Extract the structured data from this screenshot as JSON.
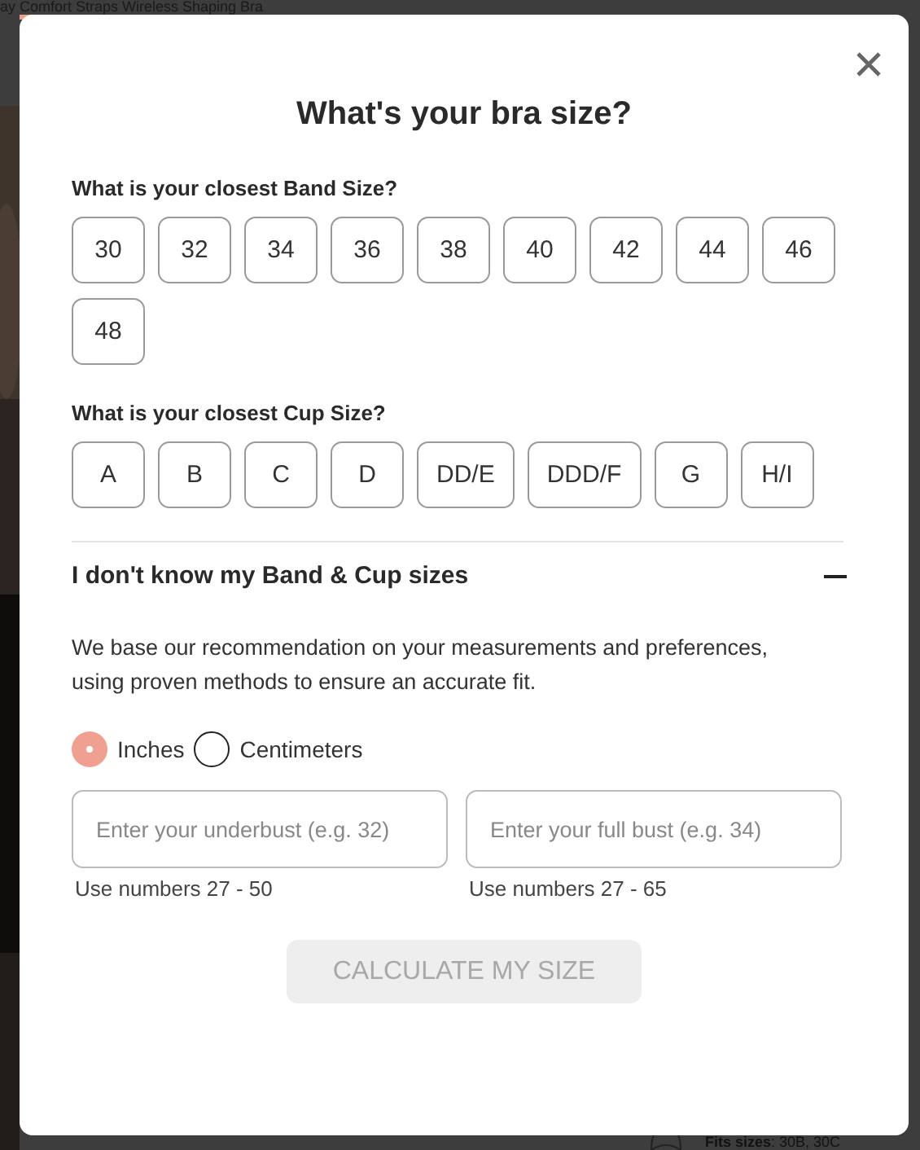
{
  "page": {
    "product_title": "ay Comfort Straps Wireless Shaping Bra",
    "fits_sizes": "**Fits sizes**: 30B, 30C"
  },
  "modal": {
    "title": "What's your bra size?",
    "band_question": "What is your closest Band Size?",
    "band_sizes": [
      {
        "label": "30",
        "selected": false
      },
      {
        "label": "32",
        "selected": false
      },
      {
        "label": "34",
        "selected": false
      },
      {
        "label": "36",
        "selected": false
      },
      {
        "label": "38",
        "selected": false
      },
      {
        "label": "40",
        "selected": false
      },
      {
        "label": "42",
        "selected": false
      },
      {
        "label": "44",
        "selected": false
      },
      {
        "label": "46",
        "selected": false
      },
      {
        "label": "48",
        "selected": false
      }
    ],
    "cup_question": "What is your closest Cup Size?",
    "cup_sizes": [
      {
        "label": "A",
        "selected": false
      },
      {
        "label": "B",
        "selected": false
      },
      {
        "label": "C",
        "selected": false
      },
      {
        "label": "D",
        "selected": false
      },
      {
        "label": "DD/E",
        "selected": false
      },
      {
        "label": "DDD/F",
        "selected": false
      },
      {
        "label": "G",
        "selected": false
      },
      {
        "label": "H/I",
        "selected": false
      }
    ],
    "unknown_section": {
      "title": "I don't know my Band & Cup sizes",
      "expanded": true
    },
    "description": "We base our recommendation on your measurements and preferences, using proven methods to ensure an accurate fit.",
    "units": [
      {
        "label": "Inches",
        "selected": true
      },
      {
        "label": "Centimeters",
        "selected": false
      }
    ],
    "fields": [
      {
        "placeholder": "Enter your underbust (e.g. 32)",
        "hint": "Use numbers 27 - 50"
      },
      {
        "placeholder": "Enter your full bust (e.g. 34)",
        "hint": "Use numbers 27 - 65"
      }
    ],
    "calculate_button": {
      "label": "CALCULATE MY SIZE",
      "disabled": true
    }
  }
}
